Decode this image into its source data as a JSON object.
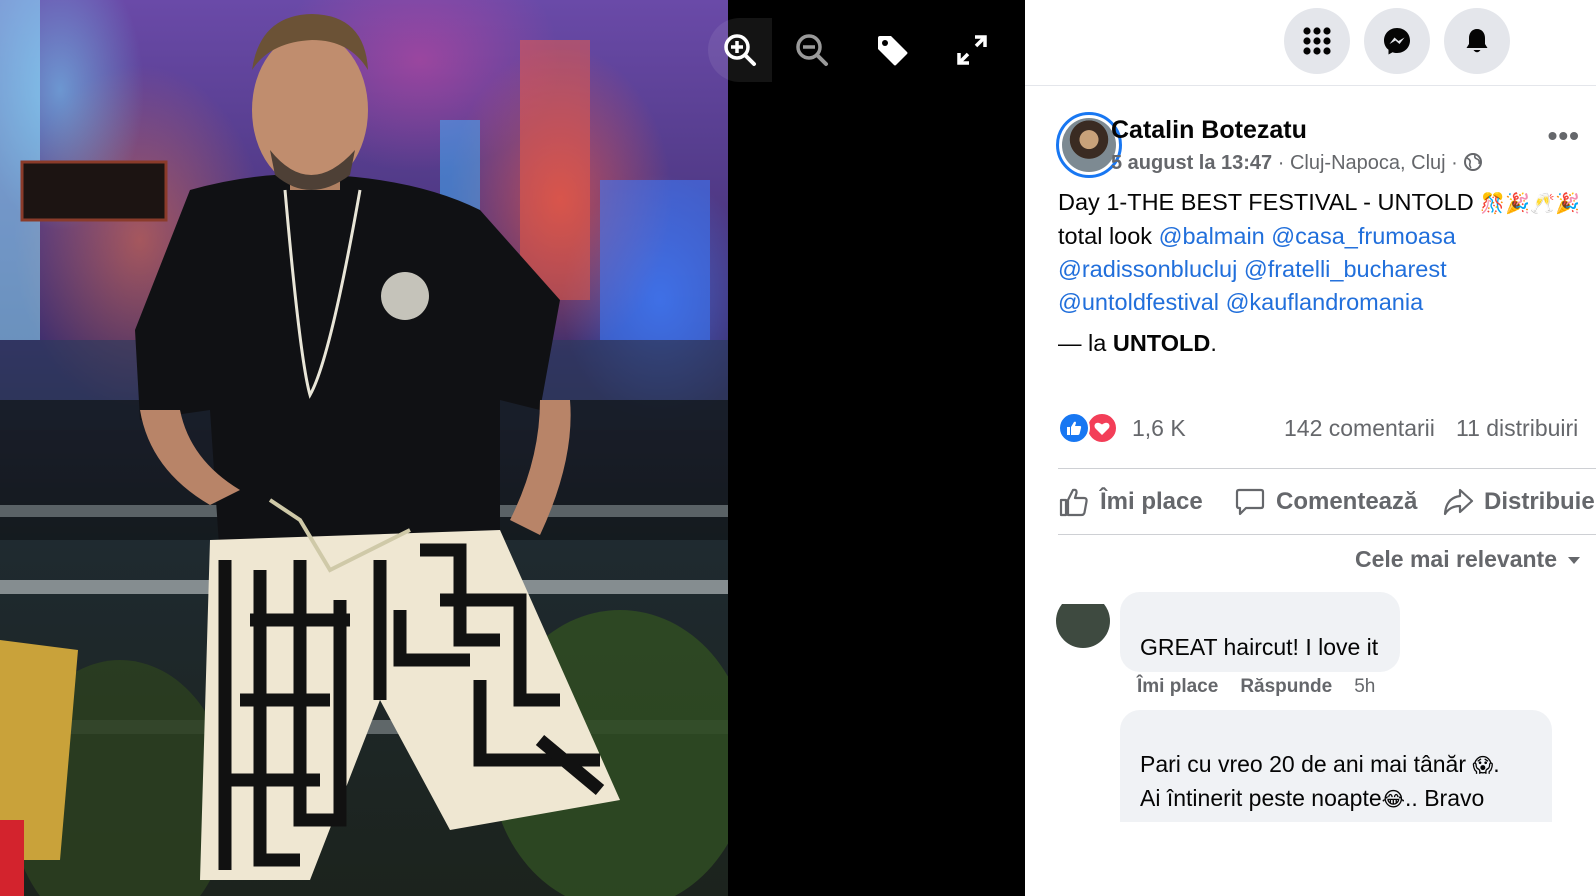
{
  "viewer": {
    "tools": [
      {
        "name": "zoom-in-icon"
      },
      {
        "name": "zoom-out-icon"
      },
      {
        "name": "tag-icon"
      },
      {
        "name": "fullscreen-icon"
      }
    ]
  },
  "topbar": {
    "icons": [
      "menu-grid-icon",
      "messenger-icon",
      "notifications-bell-icon"
    ]
  },
  "post": {
    "author": "Catalin Botezatu",
    "date": "5 august la 13:47",
    "location_meta": " · Cluj-Napoca, Cluj · ",
    "text_line1": "Day 1-THE BEST FESTIVAL - UNTOLD ",
    "text_line1_emoji": "🎊🎉🥂🎉",
    "text_line2_prefix": "total look ",
    "mentions": [
      "@balmain",
      "@casa_frumoasa",
      "@radissonblucluj",
      "@fratelli_bucharest",
      "@untoldfestival",
      "@kauflandromania"
    ],
    "location_prefix": "— la ",
    "location_name": "UNTOLD",
    "location_suffix": "."
  },
  "stats": {
    "reactions_count": "1,6 K",
    "comments_count": "142 comentarii",
    "shares_count": "11 distribuiri"
  },
  "actions": {
    "like": "Îmi place",
    "comment": "Comentează",
    "share": "Distribuie"
  },
  "sort_label": "Cele mai relevante",
  "comments": [
    {
      "text": "GREAT haircut! I love it",
      "like_label": "Îmi place",
      "reply_label": "Răspunde",
      "time": "5h"
    },
    {
      "line1": "Pari cu vreo 20 de ani mai tânăr ",
      "line1_emoji": "😱",
      "line1_end": ".",
      "line2": "Ai întinerit peste noapte",
      "line2_emoji": "😂",
      "line2_end": ".. Bravo"
    }
  ],
  "colors": {
    "accent": "#1877f2",
    "link": "#216fdb",
    "love": "#f33e58",
    "secondary_text": "#65676b"
  }
}
